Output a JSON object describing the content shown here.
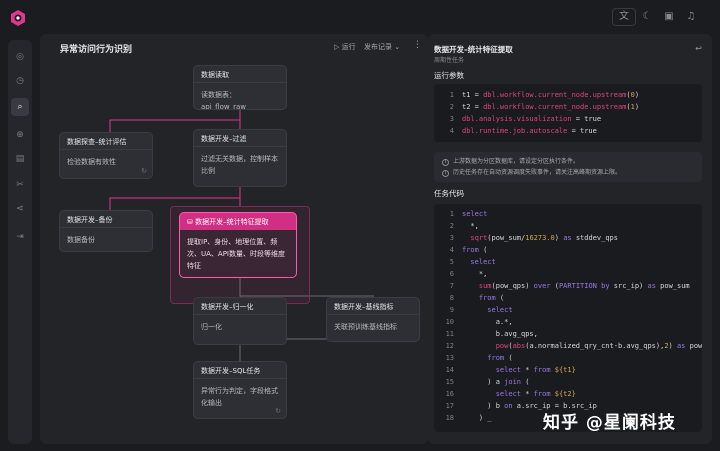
{
  "header": {
    "icons": [
      "lang-icon",
      "moon-icon",
      "book-icon",
      "bell-icon"
    ],
    "lang_label": "文"
  },
  "rail": {
    "items": [
      {
        "icon": "overview-icon",
        "glyph": "◎"
      },
      {
        "icon": "clock-icon",
        "glyph": "◷"
      },
      {
        "icon": "search-icon",
        "glyph": "⌕",
        "active": true
      },
      {
        "icon": "globe-icon",
        "glyph": "⊕"
      },
      {
        "icon": "calendar-icon",
        "glyph": "▤"
      },
      {
        "icon": "tools-icon",
        "glyph": "✂"
      },
      {
        "icon": "share-icon",
        "glyph": "⋖"
      },
      {
        "icon": "import-icon",
        "glyph": "⇥"
      }
    ]
  },
  "canvas": {
    "title": "异常访问行为识别",
    "run_label": "▷ 运行",
    "publish_label": "发布记录 ⌄",
    "more": "⋮",
    "nodes": {
      "read": {
        "title": "数据读取",
        "body": "读数据表：api_flow_raw"
      },
      "filter": {
        "title": "数据开发–过滤",
        "body": "过滤无关数据，控制样本比例"
      },
      "explore": {
        "title": "数据探查–统计评估",
        "body": "检验数据有效性"
      },
      "backup": {
        "title": "数据开发–备份",
        "body": "数据备份"
      },
      "features": {
        "title": "数据开发–统计特征提取",
        "body": "提取IP、身份、地理位置、频次、UA、API数量、时段等维度特征"
      },
      "normalize": {
        "title": "数据开发–归一化",
        "body": "归一化"
      },
      "baseline": {
        "title": "数据开发–基线指标",
        "body": "关联预训练基线指标"
      },
      "sql": {
        "title": "数据开发–SQL任务",
        "body": "异常行为判定，字段格式化输出"
      }
    }
  },
  "panel": {
    "title": "数据开发–统计特征提取",
    "subtitle": "周期性任务",
    "close": "↩",
    "params_label": "运行参数",
    "notices": [
      "上游数据为分区数据库，请设定分区执行条件。",
      "历史任务存在自动资源调度失败事件，请关注高峰期资源上限。"
    ],
    "task_label": "任务代码"
  },
  "params_code": [
    {
      "ln": "1",
      "parts": [
        [
          "id",
          "t1 = "
        ],
        [
          "fn",
          "dbl.workflow.current_node.upstream"
        ],
        [
          "id",
          "("
        ],
        [
          "num",
          "0"
        ],
        [
          "id",
          ")"
        ]
      ]
    },
    {
      "ln": "2",
      "parts": [
        [
          "id",
          "t2 = "
        ],
        [
          "fn",
          "dbl.workflow.current_node.upstream"
        ],
        [
          "id",
          "("
        ],
        [
          "num",
          "1"
        ],
        [
          "id",
          ")"
        ]
      ]
    },
    {
      "ln": "3",
      "parts": [
        [
          "fn",
          "dbl.analysis.visualization"
        ],
        [
          "id",
          " = true"
        ]
      ]
    },
    {
      "ln": "4",
      "parts": [
        [
          "fn",
          "dbl.runtime.job.autoscale"
        ],
        [
          "id",
          " = true"
        ]
      ]
    }
  ],
  "sql_code": [
    {
      "ln": "1",
      "parts": [
        [
          "kw",
          "select"
        ]
      ]
    },
    {
      "ln": "2",
      "parts": [
        [
          "id",
          "  *,"
        ]
      ]
    },
    {
      "ln": "3",
      "parts": [
        [
          "fn",
          "  sqrt"
        ],
        [
          "id",
          "(pow_sum/"
        ],
        [
          "num",
          "16273.0"
        ],
        [
          "id",
          ") "
        ],
        [
          "kw",
          "as"
        ],
        [
          "id",
          " stddev_qps"
        ]
      ]
    },
    {
      "ln": "4",
      "parts": [
        [
          "kw",
          "from"
        ],
        [
          "id",
          " ("
        ]
      ]
    },
    {
      "ln": "5",
      "parts": [
        [
          "kw",
          "  select"
        ]
      ]
    },
    {
      "ln": "6",
      "parts": [
        [
          "id",
          "    *,"
        ]
      ]
    },
    {
      "ln": "7",
      "parts": [
        [
          "fn",
          "    sum"
        ],
        [
          "id",
          "(pow_qps) "
        ],
        [
          "kw",
          "over"
        ],
        [
          "id",
          " ("
        ],
        [
          "kw",
          "PARTITION by"
        ],
        [
          "id",
          " src_ip) "
        ],
        [
          "kw",
          "as"
        ],
        [
          "id",
          " pow_sum"
        ]
      ]
    },
    {
      "ln": "8",
      "parts": [
        [
          "kw",
          "    from"
        ],
        [
          "id",
          " ("
        ]
      ]
    },
    {
      "ln": "9",
      "parts": [
        [
          "kw",
          "      select"
        ]
      ]
    },
    {
      "ln": "10",
      "parts": [
        [
          "id",
          "        a.*,"
        ]
      ]
    },
    {
      "ln": "11",
      "parts": [
        [
          "id",
          "        b.avg_qps,"
        ]
      ]
    },
    {
      "ln": "12",
      "parts": [
        [
          "fn",
          "        pow"
        ],
        [
          "id",
          "("
        ],
        [
          "fn",
          "abs"
        ],
        [
          "id",
          "(a.normalized_qry_cnt-b.avg_qps),"
        ],
        [
          "num",
          "2"
        ],
        [
          "id",
          ") "
        ],
        [
          "kw",
          "as"
        ],
        [
          "id",
          " pow_qp"
        ]
      ]
    },
    {
      "ln": "13",
      "parts": [
        [
          "kw",
          "      from"
        ],
        [
          "id",
          " ("
        ]
      ]
    },
    {
      "ln": "14",
      "parts": [
        [
          "kw",
          "        select"
        ],
        [
          "id",
          " * "
        ],
        [
          "kw",
          "from"
        ],
        [
          "str",
          " ${t1}"
        ]
      ]
    },
    {
      "ln": "15",
      "parts": [
        [
          "id",
          "      ) a "
        ],
        [
          "kw",
          "join"
        ],
        [
          "id",
          " ("
        ]
      ]
    },
    {
      "ln": "16",
      "parts": [
        [
          "kw",
          "        select"
        ],
        [
          "id",
          " * "
        ],
        [
          "kw",
          "from"
        ],
        [
          "str",
          " ${t2}"
        ]
      ]
    },
    {
      "ln": "17",
      "parts": [
        [
          "id",
          "      ) b "
        ],
        [
          "kw",
          "on"
        ],
        [
          "id",
          " a.src_ip = b.src_ip"
        ]
      ]
    },
    {
      "ln": "18",
      "parts": [
        [
          "id",
          "    ) _"
        ]
      ]
    }
  ],
  "watermark": "知乎 @星阑科技"
}
